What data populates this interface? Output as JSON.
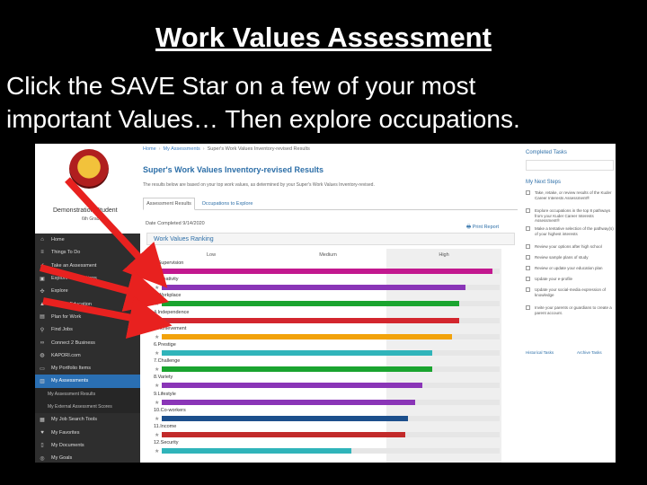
{
  "slide": {
    "title": "Work Values Assessment",
    "line1": "Click the SAVE Star on a few of your most",
    "line2": "important Values… Then explore occupations."
  },
  "sidebar": {
    "student_name": "Demonstration Student",
    "grade": "6th Grade",
    "items": [
      {
        "label": "Home",
        "icon": "home-icon",
        "active": false
      },
      {
        "label": "Things To Do",
        "icon": "list-icon",
        "active": false
      },
      {
        "label": "Take an Assessment",
        "icon": "check-icon",
        "active": false
      },
      {
        "label": "Explore Occupations",
        "icon": "briefcase-icon",
        "active": false
      },
      {
        "label": "Explore",
        "icon": "compass-icon",
        "active": false
      },
      {
        "label": "Plan for Education",
        "icon": "cap-icon",
        "active": false
      },
      {
        "label": "Plan for Work",
        "icon": "building-icon",
        "active": false
      },
      {
        "label": "Find Jobs",
        "icon": "search-icon",
        "active": false
      },
      {
        "label": "Connect 2 Business",
        "icon": "link-icon",
        "active": false
      },
      {
        "label": "KAPORI.com",
        "icon": "globe-icon",
        "active": false
      },
      {
        "label": "My Portfolio Items",
        "icon": "folder-icon",
        "active": false
      },
      {
        "label": "My Assessments",
        "icon": "chart-icon",
        "active": true
      },
      {
        "label": "My Assessment Results",
        "icon": "",
        "sub": true
      },
      {
        "label": "My External Assessment Scores",
        "icon": "",
        "sub": true
      },
      {
        "label": "My Job Search Tools",
        "icon": "toolbox-icon",
        "active": false
      },
      {
        "label": "My Favorites",
        "icon": "heart-icon",
        "active": false
      },
      {
        "label": "My Documents",
        "icon": "document-icon",
        "active": false
      },
      {
        "label": "My Goals",
        "icon": "target-icon",
        "active": false
      }
    ]
  },
  "main": {
    "breadcrumb": [
      "Home",
      "My Assessments",
      "Super's Work Values Inventory-revised Results"
    ],
    "title": "Super's Work Values Inventory-revised Results",
    "description": "The results below are based on your top work values, as determined by your Super's Work Values Inventory-revised.",
    "tabs": [
      "Assessment Results",
      "Occupations to Explore"
    ],
    "date_completed": "Date Completed 9/14/2020",
    "print_label": "Print Report",
    "panel_title": "Work Values Ranking",
    "columns": [
      "Low",
      "Medium",
      "High"
    ]
  },
  "chart_data": {
    "type": "bar",
    "orientation": "horizontal",
    "title": "Work Values Ranking",
    "xlabel": "",
    "ylabel": "",
    "band_labels": [
      "Low",
      "Medium",
      "High"
    ],
    "xlim": [
      0,
      1
    ],
    "categories": [
      "1.Supervision",
      "2.Creativity",
      "3.Workplace",
      "4.Independence",
      "5.Achievement",
      "6.Prestige",
      "7.Challenge",
      "8.Variety",
      "9.Lifestyle",
      "10.Co-workers",
      "11.Income",
      "12.Security"
    ],
    "values": [
      0.98,
      0.9,
      0.88,
      0.88,
      0.86,
      0.8,
      0.8,
      0.77,
      0.75,
      0.73,
      0.72,
      0.56
    ],
    "colors": [
      "#c2188f",
      "#8a35b7",
      "#1aa42f",
      "#d3262e",
      "#f2a20a",
      "#30b4ba",
      "#1aa42f",
      "#8a35b7",
      "#8a35b7",
      "#1c4f8c",
      "#c22a2a",
      "#30b4ba"
    ]
  },
  "right": {
    "completed_title": "Completed Tasks",
    "next_title": "My Next Steps",
    "steps": [
      "Take, retake, or review results of the Kuder Career Interests Assessment®",
      "Explore occupations in the top 8 pathways from your Kuder Career Interests Assessment®",
      "Make a tentative selection of the pathway(s) of your highest interests",
      "Review your options after high school",
      "Review sample plans of study",
      "Review or update your education plan",
      "Update your e-profile",
      "Update your social-media expression of knowledge",
      "Invite your parents or guardians to create a parent account."
    ],
    "historical_tasks": "Historical Tasks",
    "archive_tasks": "Archive Tasks"
  },
  "colors": {
    "arrow": "#e8211f",
    "accent": "#2d6fa8"
  }
}
